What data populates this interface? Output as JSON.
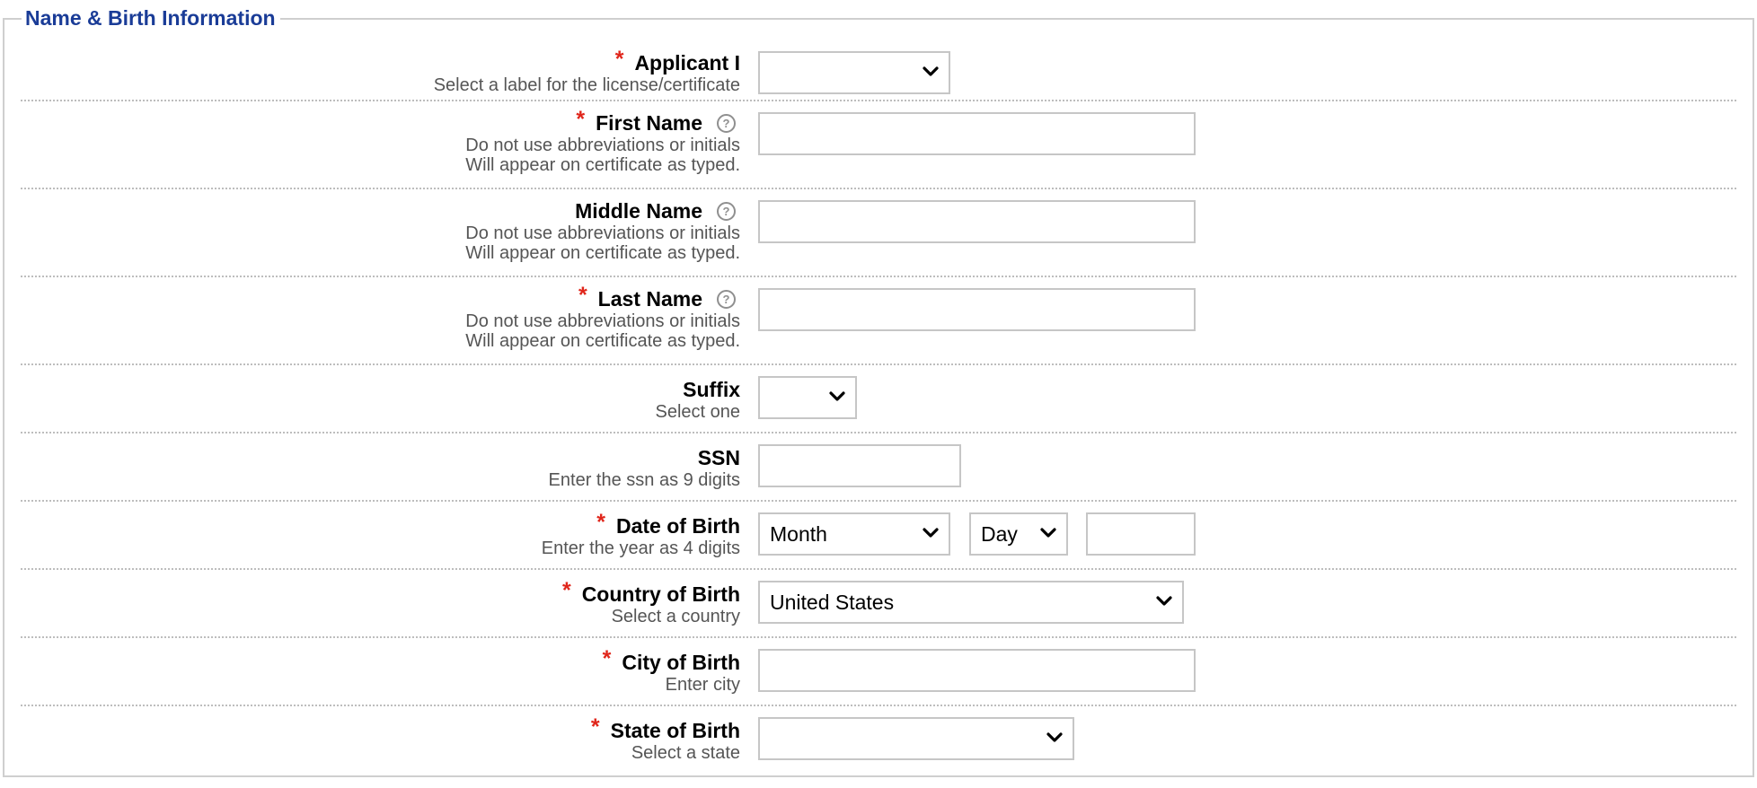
{
  "section": {
    "legend": "Name & Birth Information"
  },
  "fields": {
    "applicant": {
      "label": "Applicant I",
      "hint": "Select a label for the license/certificate",
      "required": "*",
      "value": ""
    },
    "first_name": {
      "label": "First Name",
      "hint1": "Do not use abbreviations or initials",
      "hint2": "Will appear on certificate as typed.",
      "required": "*",
      "help": "?",
      "value": ""
    },
    "middle_name": {
      "label": "Middle Name",
      "hint1": "Do not use abbreviations or initials",
      "hint2": "Will appear on certificate as typed.",
      "help": "?",
      "value": ""
    },
    "last_name": {
      "label": "Last Name",
      "hint1": "Do not use abbreviations or initials",
      "hint2": "Will appear on certificate as typed.",
      "required": "*",
      "help": "?",
      "value": ""
    },
    "suffix": {
      "label": "Suffix",
      "hint": "Select one",
      "value": ""
    },
    "ssn": {
      "label": "SSN",
      "hint": "Enter the ssn as 9 digits",
      "value": ""
    },
    "dob": {
      "label": "Date of Birth",
      "hint": "Enter the year as 4 digits",
      "required": "*",
      "month": "Month",
      "day": "Day",
      "year": ""
    },
    "country": {
      "label": "Country of Birth",
      "hint": "Select a country",
      "required": "*",
      "value": "United States"
    },
    "city": {
      "label": "City of Birth",
      "hint": "Enter city",
      "required": "*",
      "value": ""
    },
    "state": {
      "label": "State of Birth",
      "hint": "Select a state",
      "required": "*",
      "value": ""
    }
  },
  "icons": {
    "help": "help-icon",
    "dropdown": "chevron-down-icon"
  },
  "colors": {
    "legend": "#1a3c97",
    "required": "#e0261b",
    "hint": "#555555",
    "border": "#c6c6c6"
  }
}
